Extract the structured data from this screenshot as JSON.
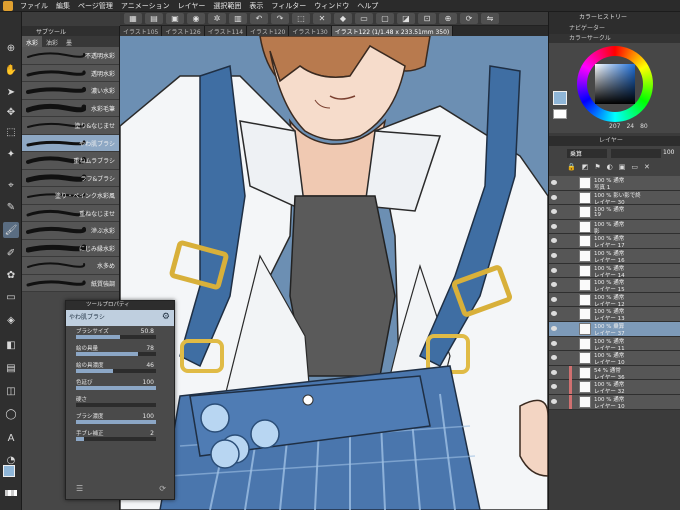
{
  "menubar": {
    "items": [
      "ファイル",
      "編集",
      "ページ管理",
      "アニメーション",
      "レイヤー",
      "選択範囲",
      "表示",
      "フィルター",
      "ウィンドウ",
      "ヘルプ"
    ]
  },
  "document_tabs": [
    "イラスト105",
    "イラスト126",
    "イラスト114",
    "イラスト120",
    "イラスト130",
    "イラスト122 (1/1.48 x 233.51mm 350)"
  ],
  "subtool": {
    "header": "サブツール",
    "tabs": [
      "水彩",
      "油彩",
      "墨"
    ],
    "brushes": [
      "不透明水彩",
      "透明水彩",
      "濃い水彩",
      "水彩毛筆",
      "塗り&なじませ",
      "やわ肌ブラシ",
      "重ねムラブラシ",
      "ラフ&ブラシ",
      "塗り・ペインク水彩風",
      "重ねなじませ",
      "滲ぶ水彩",
      "にじみ縁水彩",
      "水多め",
      "紙質強調"
    ],
    "active_index": 5
  },
  "tool_property": {
    "title": "ツールプロパティ",
    "brush_name": "やわ肌ブラシ",
    "props": [
      {
        "label": "ブラシサイズ",
        "value": "50.8",
        "fill": 0.55
      },
      {
        "label": "絵の具量",
        "value": "78",
        "fill": 0.78
      },
      {
        "label": "絵の具濃度",
        "value": "46",
        "fill": 0.46
      },
      {
        "label": "色延び",
        "value": "100",
        "fill": 1.0
      },
      {
        "label": "硬さ",
        "value": "",
        "fill": 0.0
      },
      {
        "label": "ブラシ濃度",
        "value": "100",
        "fill": 1.0
      },
      {
        "label": "手ブレ補正",
        "value": "2",
        "fill": 0.1
      }
    ]
  },
  "right_panel": {
    "history_title": "カラーヒストリー",
    "navigator_title": "ナビゲーター",
    "color_title": "カラーサークル",
    "color_values": {
      "h": "207",
      "s": "24",
      "v": "80"
    },
    "main_color": "#8fb6d8",
    "layer_title": "レイヤー",
    "blend_mode": "乗算",
    "opacity": "100",
    "layers": [
      {
        "line1": "100 % 通常",
        "line2": "写真 1",
        "sel": false
      },
      {
        "line1": "100 % 影い影で終",
        "line2": "レイヤー 30",
        "sel": false
      },
      {
        "line1": "100 % 通常",
        "line2": "19",
        "sel": false
      },
      {
        "line1": "100 % 通常",
        "line2": "影",
        "sel": false
      },
      {
        "line1": "100 % 通常",
        "line2": "レイヤー 17",
        "sel": false
      },
      {
        "line1": "100 % 通常",
        "line2": "レイヤー 16",
        "sel": false
      },
      {
        "line1": "100 % 通常",
        "line2": "レイヤー 14",
        "sel": false
      },
      {
        "line1": "100 % 通常",
        "line2": "レイヤー 15",
        "sel": false
      },
      {
        "line1": "100 % 通常",
        "line2": "レイヤー 12",
        "sel": false
      },
      {
        "line1": "100 % 通常",
        "line2": "レイヤー 13",
        "sel": false
      },
      {
        "line1": "100 % 乗算",
        "line2": "レイヤー 37",
        "sel": true
      },
      {
        "line1": "100 % 通常",
        "line2": "レイヤー 11",
        "sel": false
      },
      {
        "line1": "100 % 通常",
        "line2": "レイヤー 10",
        "sel": false
      },
      {
        "line1": "54 % 通常",
        "line2": "レイヤー 36",
        "sel": false
      },
      {
        "line1": "100 % 通常",
        "line2": "レイヤー 32",
        "sel": false
      },
      {
        "line1": "100 % 通常",
        "line2": "レイヤー 10",
        "sel": false
      }
    ]
  }
}
